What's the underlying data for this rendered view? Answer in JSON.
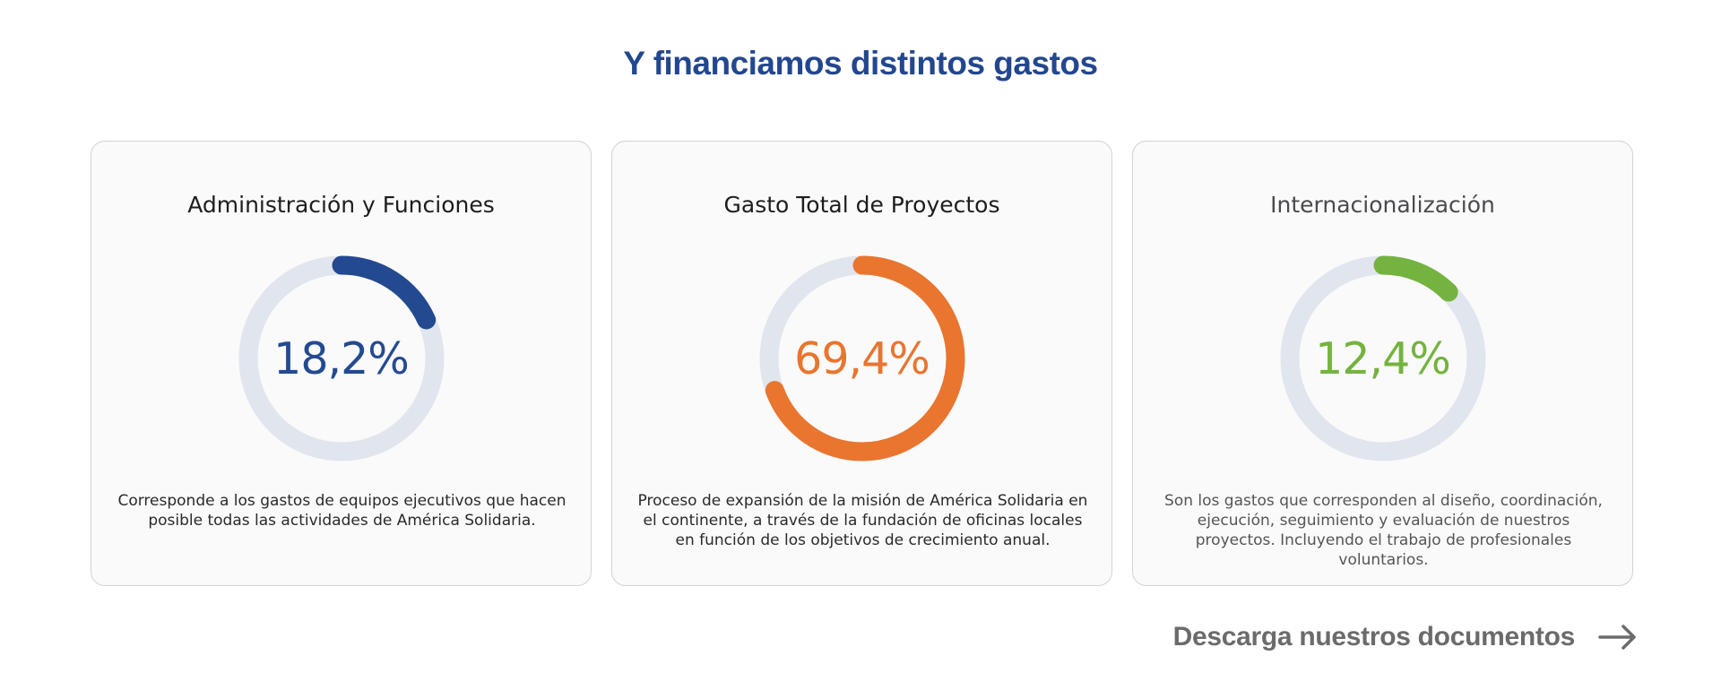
{
  "section": {
    "title": "Y financiamos distintos gastos"
  },
  "cards": [
    {
      "title": "Administración y Funciones",
      "value_label": "18,2%",
      "percent": 18.2,
      "color": "#234a91",
      "description": "Corresponde a los gastos de equipos ejecutivos que hacen posible todas las actividades de América Solidaria."
    },
    {
      "title": "Gasto Total de Proyectos",
      "value_label": "69,4%",
      "percent": 69.4,
      "color": "#e9752f",
      "description": "Proceso de expansión de la misión de América Solidaria en el continente, a través de la fundación de oficinas locales en función de los objetivos de crecimiento anual."
    },
    {
      "title": "Internacionalización",
      "value_label": "12,4%",
      "percent": 12.4,
      "color": "#74b33f",
      "description": "Son los gastos que corresponden al diseño, coordinación, ejecución, seguimiento y evaluación de nuestros proyectos. Incluyendo el trabajo de profesionales voluntarios."
    }
  ],
  "colors": {
    "track": "#e1e5ee",
    "title": "#23478f",
    "link": "#6b6b6b"
  },
  "download": {
    "label": "Descarga nuestros documentos",
    "icon": "arrow-right-icon"
  }
}
